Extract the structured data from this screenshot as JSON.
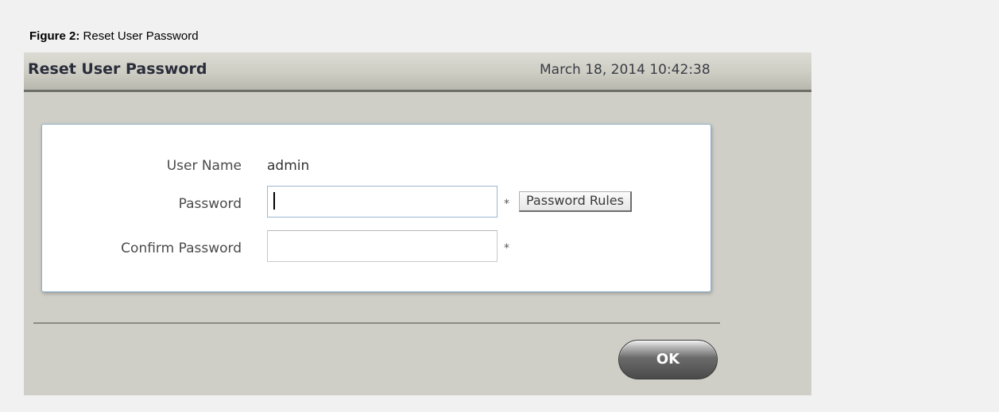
{
  "caption": {
    "label": "Figure 2:",
    "text": "Reset User Password"
  },
  "window": {
    "title": "Reset User Password",
    "datetime": "March 18, 2014 10:42:38"
  },
  "form": {
    "username_label": "User Name",
    "username_value": "admin",
    "password_label": "Password",
    "password_value": "",
    "confirm_label": "Confirm Password",
    "confirm_value": "",
    "required_marker": "*",
    "password_rules_button": "Password Rules"
  },
  "footer": {
    "ok_label": "OK"
  }
}
